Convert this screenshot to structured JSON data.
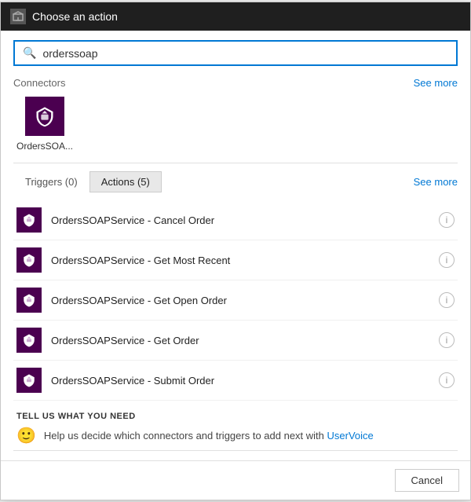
{
  "titlebar": {
    "title": "Choose an action",
    "icon": "action-icon"
  },
  "search": {
    "placeholder": "orderssoap",
    "value": "orderssoap"
  },
  "connectors": {
    "label": "Connectors",
    "see_more_label": "See more",
    "items": [
      {
        "name": "OrdersSOA...",
        "icon": "box-icon"
      }
    ]
  },
  "tabs": [
    {
      "label": "Triggers (0)",
      "active": false
    },
    {
      "label": "Actions (5)",
      "active": true
    }
  ],
  "see_more_label": "See more",
  "actions": [
    {
      "name": "OrdersSOAPService - Cancel Order",
      "icon": "box-icon"
    },
    {
      "name": "OrdersSOAPService - Get Most Recent",
      "icon": "box-icon"
    },
    {
      "name": "OrdersSOAPService - Get Open Order",
      "icon": "box-icon"
    },
    {
      "name": "OrdersSOAPService - Get Order",
      "icon": "box-icon"
    },
    {
      "name": "OrdersSOAPService - Submit Order",
      "icon": "box-icon"
    }
  ],
  "feedback": {
    "title": "TELL US WHAT YOU NEED",
    "text": "Help us decide which connectors and triggers to add next with ",
    "link_label": "UserVoice"
  },
  "footer": {
    "cancel_label": "Cancel"
  }
}
